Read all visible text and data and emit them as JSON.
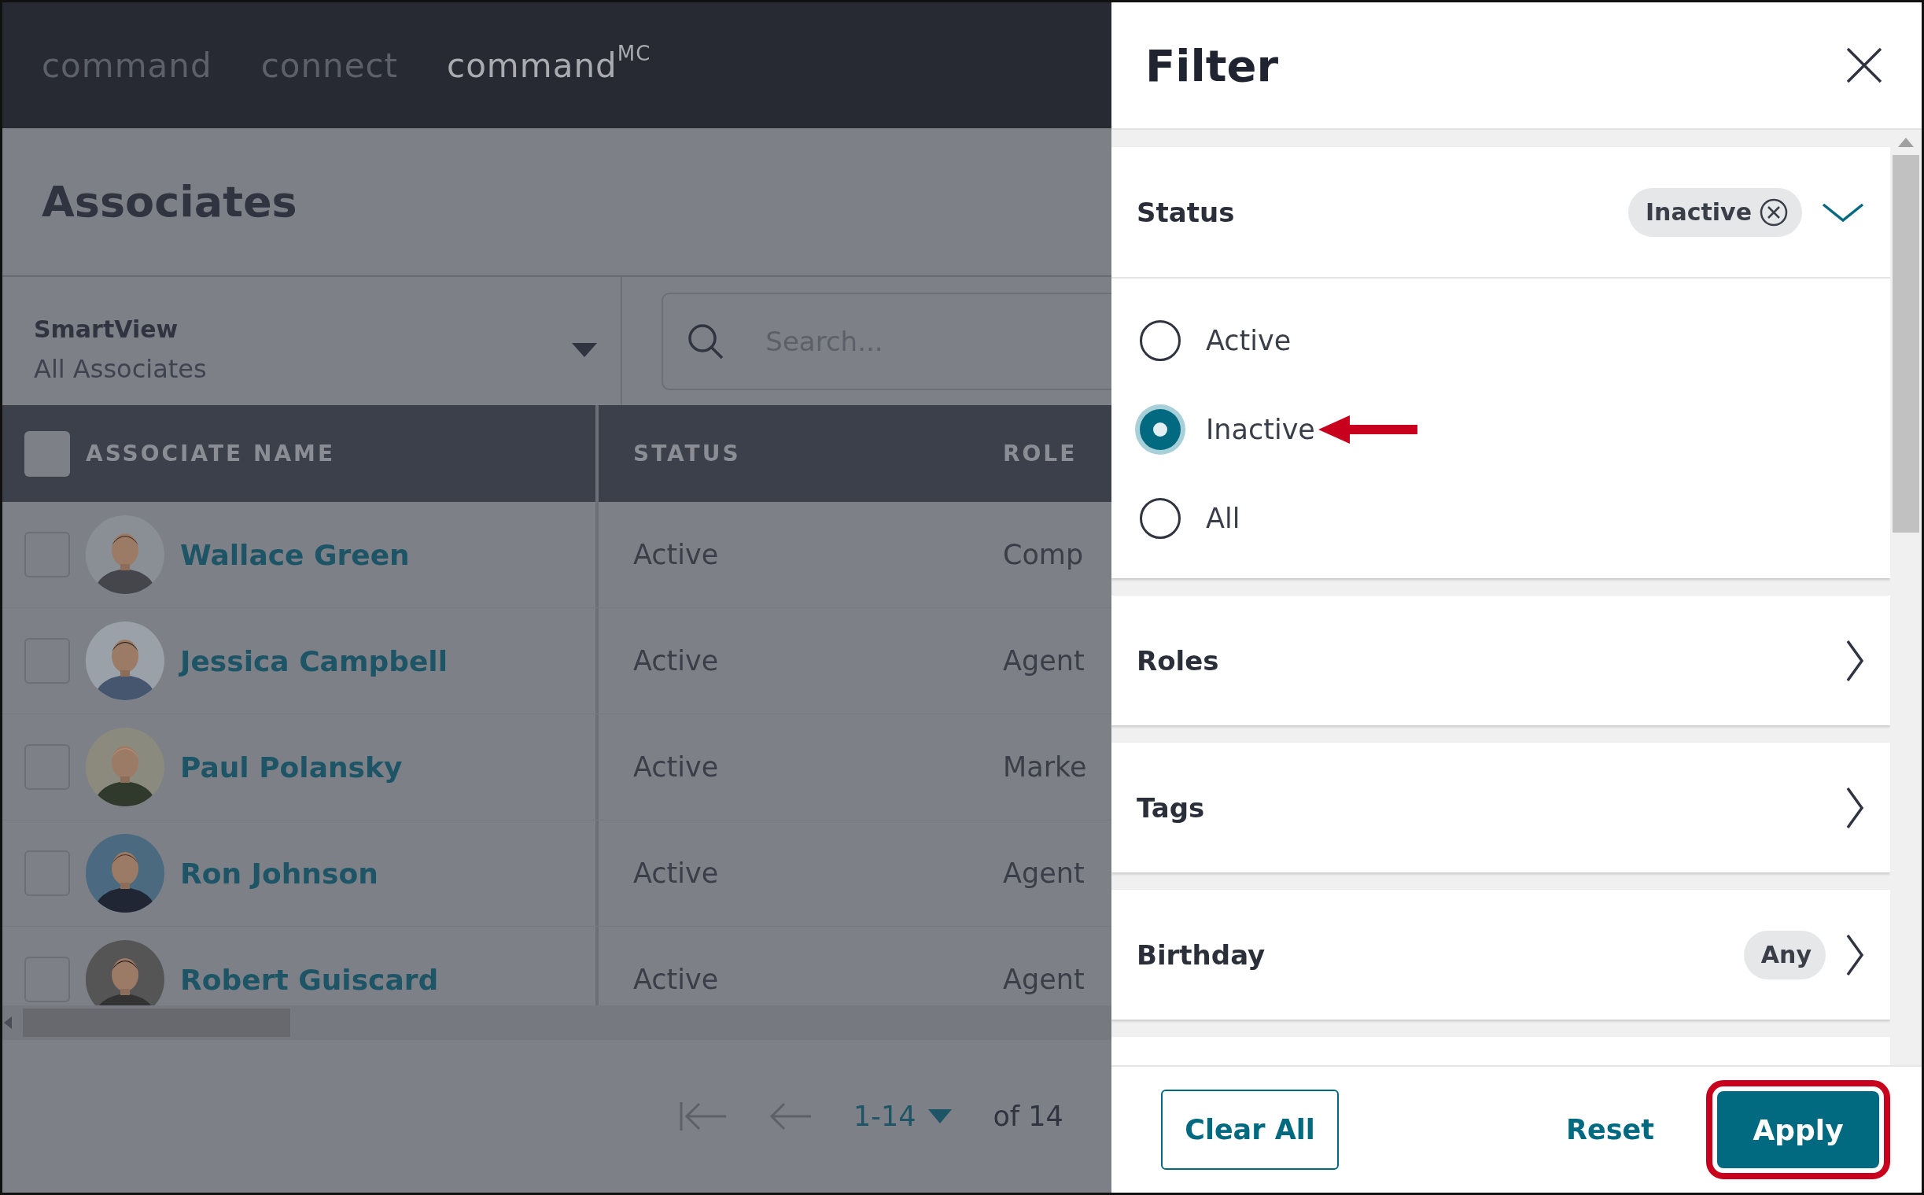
{
  "nav": [
    {
      "label": "command",
      "selected": false
    },
    {
      "label": "connect",
      "selected": false
    },
    {
      "label": "command$^{MC}$",
      "selected": true
    }
  ],
  "page_title": "Associates",
  "smartview": {
    "label": "SmartView",
    "value": "All Associates"
  },
  "search": {
    "placeholder": "Search..."
  },
  "table": {
    "columns": [
      "ASSOCIATE NAME",
      "STATUS",
      "ROLE"
    ],
    "all_checked": false,
    "rows": [
      {
        "name": "Wallace Green",
        "status": "Active",
        "role": "Comp",
        "checked": false
      },
      {
        "name": "Jessica Campbell",
        "status": "Active",
        "role": "Agent",
        "checked": false
      },
      {
        "name": "Paul Polansky",
        "status": "Active",
        "role": "Marke",
        "checked": false
      },
      {
        "name": "Ron Johnson",
        "status": "Active",
        "role": "Agent",
        "checked": false
      },
      {
        "name": "Robert Guiscard",
        "status": "Active",
        "role": "Agent",
        "checked": false
      }
    ]
  },
  "pagination": {
    "range": "1-14",
    "total": "of 14"
  },
  "filter": {
    "title": "Filter",
    "sections": [
      {
        "label": "Status",
        "expanded": true,
        "chip": "Inactive",
        "options": [
          {
            "label": "Active",
            "selected": false
          },
          {
            "label": "Inactive",
            "selected": true
          },
          {
            "label": "All",
            "selected": false
          }
        ]
      },
      {
        "label": "Roles",
        "expanded": false
      },
      {
        "label": "Tags",
        "expanded": false
      },
      {
        "label": "Birthday",
        "expanded": false,
        "chip": "Any"
      }
    ],
    "clear_button": "Clear All",
    "reset_button": "Reset",
    "apply_button": "Apply"
  }
}
